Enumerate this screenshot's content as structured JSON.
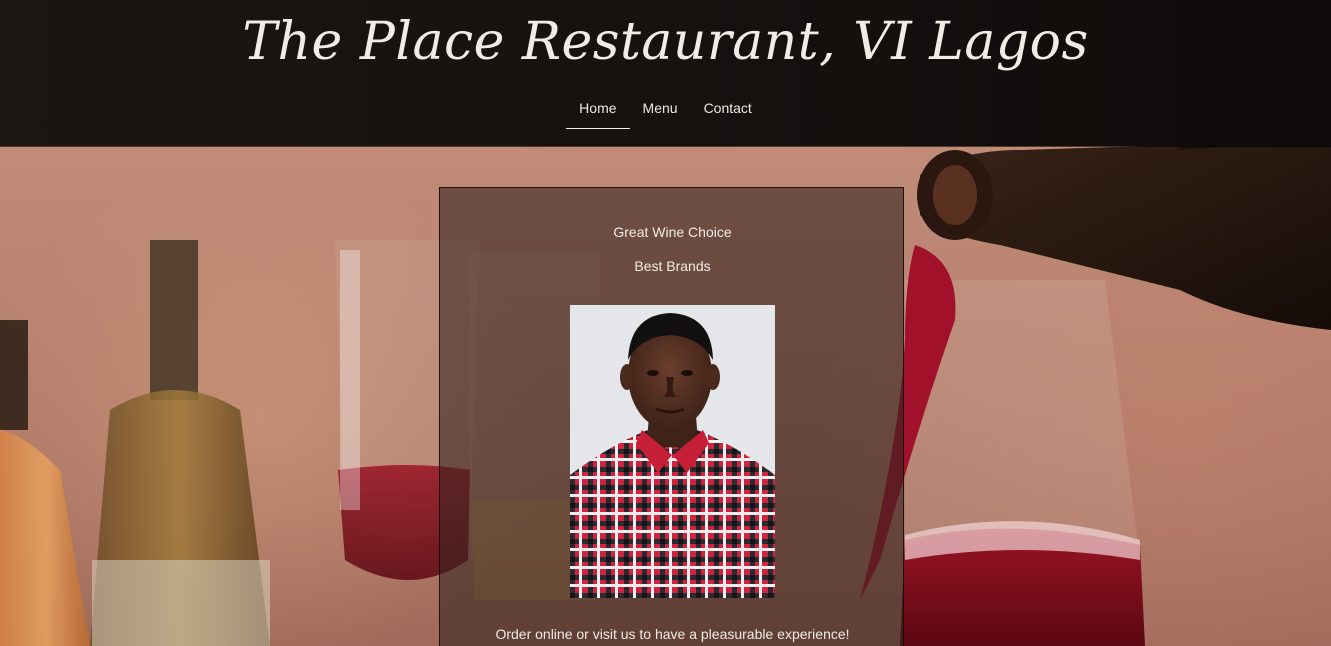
{
  "header": {
    "site_title": "The Place Restaurant, VI Lagos",
    "nav": [
      {
        "label": "Home",
        "active": true
      },
      {
        "label": "Menu",
        "active": false
      },
      {
        "label": "Contact",
        "active": false
      }
    ]
  },
  "card": {
    "line1": "Great Wine Choice",
    "line2": "Best Brands",
    "line3": "Order online or visit us to have a pleasurable experience!"
  },
  "colors": {
    "header_bg": "#161210",
    "text_light": "#f1ebe5",
    "card_bg": "rgba(52,34,30,0.58)",
    "wine_red": "#8e0f1c"
  },
  "icons": {
    "background_image": "wine-pouring-photo",
    "portrait_image": "man-in-plaid-shirt-photo"
  }
}
